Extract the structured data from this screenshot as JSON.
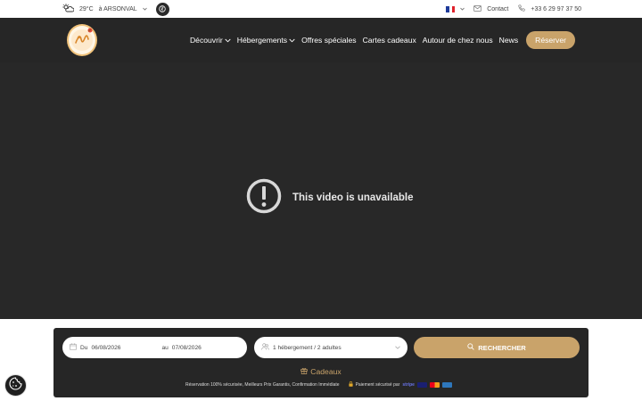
{
  "topbar": {
    "weather_temp": "29°C",
    "weather_location": "à ARSONVAL",
    "contact_label": "Contact",
    "phone": "+33 6 29 97 37 50"
  },
  "nav": {
    "items": [
      {
        "label": "Découvrir",
        "has_dropdown": true
      },
      {
        "label": "Hébergements",
        "has_dropdown": true
      },
      {
        "label": "Offres spéciales",
        "has_dropdown": false
      },
      {
        "label": "Cartes cadeaux",
        "has_dropdown": false
      },
      {
        "label": "Autour de chez nous",
        "has_dropdown": false
      },
      {
        "label": "News",
        "has_dropdown": false
      }
    ],
    "reserve_label": "Réserver"
  },
  "video": {
    "message": "This video is unavailable"
  },
  "booking": {
    "from_prefix": "Du",
    "from_date": "06/08/2026",
    "to_prefix": "au",
    "to_date": "07/08/2026",
    "guests": "1 hébergement / 2 adultes",
    "search_label": "RECHERCHER",
    "gifts_label": "Cadeaux",
    "reassurance": "Réservation 100% sécurisée, Meilleurs Prix Garantis, Confirmation Immédiate",
    "payment_label": "Paiement sécurisé par",
    "payment_provider": "stripe"
  },
  "colors": {
    "accent": "#c9a36a",
    "dark": "#262626",
    "video_bg": "#282828"
  },
  "icons": [
    "weather-sun-cloud-icon",
    "eco-leaf-icon",
    "flag-fr-icon",
    "mail-icon",
    "phone-icon",
    "chevron-down-icon",
    "alert-circle-icon",
    "calendar-icon",
    "users-icon",
    "search-icon",
    "gift-icon",
    "lock-icon",
    "cookie-icon"
  ]
}
